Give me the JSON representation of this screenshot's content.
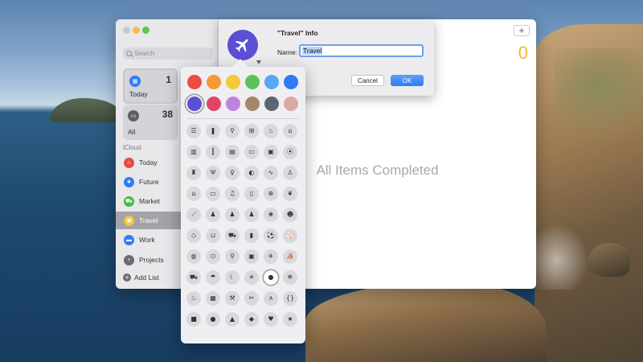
{
  "sidebar": {
    "search_placeholder": "Search",
    "smart_lists": [
      {
        "label": "Today",
        "count": "1",
        "icon": "calendar-icon",
        "glyph": "▦"
      },
      {
        "label": "All",
        "count": "38",
        "icon": "tray-icon",
        "glyph": "▭"
      }
    ],
    "section_label": "iCloud",
    "lists": [
      {
        "label": "Today",
        "icon": "house-icon",
        "glyph": "⌂",
        "color": "#e8493f"
      },
      {
        "label": "Future",
        "icon": "star-icon",
        "glyph": "★",
        "color": "#2f7cf6"
      },
      {
        "label": "Market",
        "icon": "cart-icon",
        "glyph": "⛟",
        "color": "#4cb748"
      },
      {
        "label": "Travel",
        "icon": "suitcase-icon",
        "glyph": "▣",
        "color": "#f2c63b"
      },
      {
        "label": "Work",
        "icon": "laptop-icon",
        "glyph": "▬",
        "color": "#2f7cf6"
      },
      {
        "label": "Projects",
        "icon": "utensils-icon",
        "glyph": "⑂",
        "color": "#6b6b70"
      }
    ],
    "add_list_label": "Add List"
  },
  "content": {
    "add_button": "+",
    "count": "0",
    "empty_message": "All Items Completed"
  },
  "sheet": {
    "title": "\"Travel\" Info",
    "name_label": "Name:",
    "name_value": "Travel",
    "cancel_label": "Cancel",
    "ok_label": "OK",
    "list_icon": "airplane-icon",
    "list_color": "#5b4fd3"
  },
  "popover": {
    "colors": [
      "#ea4d43",
      "#f19a37",
      "#f4c93e",
      "#5bc25b",
      "#5ba6f3",
      "#2d7cf5",
      "#5b4fd3",
      "#e3446b",
      "#bd84de",
      "#a3866a",
      "#5c6670",
      "#d9a9a4"
    ],
    "selected_color_index": 6,
    "selected_icon_index": 46,
    "icons": [
      {
        "name": "list-bullet-icon",
        "glyph": "☰"
      },
      {
        "name": "bookmark-icon",
        "glyph": "❚"
      },
      {
        "name": "pin-icon",
        "glyph": "⚲"
      },
      {
        "name": "gift-icon",
        "glyph": "⊞"
      },
      {
        "name": "birthday-cake-icon",
        "glyph": "♨"
      },
      {
        "name": "graduation-cap-icon",
        "glyph": "⌂"
      },
      {
        "name": "backpack-icon",
        "glyph": "▥"
      },
      {
        "name": "ruler-pencil-icon",
        "glyph": "║"
      },
      {
        "name": "document-icon",
        "glyph": "▤"
      },
      {
        "name": "credit-card-icon",
        "glyph": "▭"
      },
      {
        "name": "money-icon",
        "glyph": "▣"
      },
      {
        "name": "dumbbell-icon",
        "glyph": "⦿"
      },
      {
        "name": "running-figure-icon",
        "glyph": "♜"
      },
      {
        "name": "fork-knife-icon",
        "glyph": "Ψ"
      },
      {
        "name": "wine-glass-icon",
        "glyph": "♀"
      },
      {
        "name": "pills-icon",
        "glyph": "◐"
      },
      {
        "name": "stethoscope-icon",
        "glyph": "∿"
      },
      {
        "name": "chair-icon",
        "glyph": "♙"
      },
      {
        "name": "house-icon",
        "glyph": "⌂"
      },
      {
        "name": "monitor-icon",
        "glyph": "▭"
      },
      {
        "name": "music-note-icon",
        "glyph": "♫"
      },
      {
        "name": "computer-icon",
        "glyph": "▯"
      },
      {
        "name": "gamepad-icon",
        "glyph": "⊕"
      },
      {
        "name": "leaf-icon",
        "glyph": "❦"
      },
      {
        "name": "carrot-icon",
        "glyph": "⟋"
      },
      {
        "name": "person-icon",
        "glyph": "♟"
      },
      {
        "name": "people-icon",
        "glyph": "♟"
      },
      {
        "name": "family-icon",
        "glyph": "♟"
      },
      {
        "name": "paw-icon",
        "glyph": "❀"
      },
      {
        "name": "teddy-bear-icon",
        "glyph": "☻"
      },
      {
        "name": "fish-icon",
        "glyph": "◇"
      },
      {
        "name": "basket-icon",
        "glyph": "⊔"
      },
      {
        "name": "shopping-cart-icon",
        "glyph": "⛟"
      },
      {
        "name": "shopping-bag-icon",
        "glyph": "▮"
      },
      {
        "name": "soccer-ball-icon",
        "glyph": "⚽"
      },
      {
        "name": "baseball-icon",
        "glyph": "⚾"
      },
      {
        "name": "basketball-icon",
        "glyph": "◍"
      },
      {
        "name": "football-icon",
        "glyph": "⬭"
      },
      {
        "name": "tennis-racket-icon",
        "glyph": "⚲"
      },
      {
        "name": "train-icon",
        "glyph": "▣"
      },
      {
        "name": "airplane-icon",
        "glyph": "✈"
      },
      {
        "name": "sailboat-icon",
        "glyph": "⛵"
      },
      {
        "name": "car-icon",
        "glyph": "⛟"
      },
      {
        "name": "umbrella-icon",
        "glyph": "☂"
      },
      {
        "name": "moon-icon",
        "glyph": "☾"
      },
      {
        "name": "sun-icon",
        "glyph": "☀"
      },
      {
        "name": "drop-icon",
        "glyph": "●"
      },
      {
        "name": "snowflake-icon",
        "glyph": "❄"
      },
      {
        "name": "flame-icon",
        "glyph": "♨"
      },
      {
        "name": "toolbox-icon",
        "glyph": "▦"
      },
      {
        "name": "tools-icon",
        "glyph": "⚒"
      },
      {
        "name": "scissors-icon",
        "glyph": "✂"
      },
      {
        "name": "compass-drafting-icon",
        "glyph": "∧"
      },
      {
        "name": "code-braces-icon",
        "glyph": "{}"
      },
      {
        "name": "square-shape-icon",
        "glyph": "■"
      },
      {
        "name": "circle-shape-icon",
        "glyph": "●"
      },
      {
        "name": "triangle-shape-icon",
        "glyph": "▲"
      },
      {
        "name": "diamond-shape-icon",
        "glyph": "◆"
      },
      {
        "name": "heart-shape-icon",
        "glyph": "♥"
      },
      {
        "name": "star-shape-icon",
        "glyph": "★"
      }
    ]
  }
}
